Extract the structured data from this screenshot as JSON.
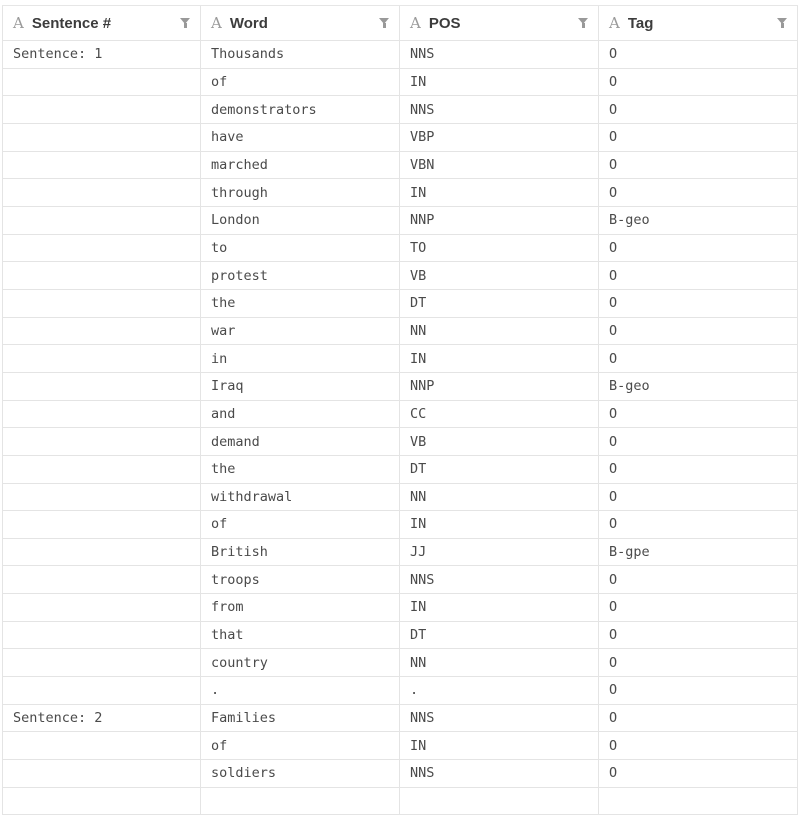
{
  "columns": [
    {
      "label": "Sentence #",
      "type_icon": "A"
    },
    {
      "label": "Word",
      "type_icon": "A"
    },
    {
      "label": "POS",
      "type_icon": "A"
    },
    {
      "label": "Tag",
      "type_icon": "A"
    }
  ],
  "rows": [
    [
      "Sentence: 1",
      "Thousands",
      "NNS",
      "O"
    ],
    [
      "",
      "of",
      "IN",
      "O"
    ],
    [
      "",
      "demonstrators",
      "NNS",
      "O"
    ],
    [
      "",
      "have",
      "VBP",
      "O"
    ],
    [
      "",
      "marched",
      "VBN",
      "O"
    ],
    [
      "",
      "through",
      "IN",
      "O"
    ],
    [
      "",
      "London",
      "NNP",
      "B-geo"
    ],
    [
      "",
      "to",
      "TO",
      "O"
    ],
    [
      "",
      "protest",
      "VB",
      "O"
    ],
    [
      "",
      "the",
      "DT",
      "O"
    ],
    [
      "",
      "war",
      "NN",
      "O"
    ],
    [
      "",
      "in",
      "IN",
      "O"
    ],
    [
      "",
      "Iraq",
      "NNP",
      "B-geo"
    ],
    [
      "",
      "and",
      "CC",
      "O"
    ],
    [
      "",
      "demand",
      "VB",
      "O"
    ],
    [
      "",
      "the",
      "DT",
      "O"
    ],
    [
      "",
      "withdrawal",
      "NN",
      "O"
    ],
    [
      "",
      "of",
      "IN",
      "O"
    ],
    [
      "",
      "British",
      "JJ",
      "B-gpe"
    ],
    [
      "",
      "troops",
      "NNS",
      "O"
    ],
    [
      "",
      "from",
      "IN",
      "O"
    ],
    [
      "",
      "that",
      "DT",
      "O"
    ],
    [
      "",
      "country",
      "NN",
      "O"
    ],
    [
      "",
      ".",
      ".",
      "O"
    ],
    [
      "Sentence: 2",
      "Families",
      "NNS",
      "O"
    ],
    [
      "",
      "of",
      "IN",
      "O"
    ],
    [
      "",
      "soldiers",
      "NNS",
      "O"
    ],
    [
      "",
      "",
      "",
      ""
    ]
  ]
}
